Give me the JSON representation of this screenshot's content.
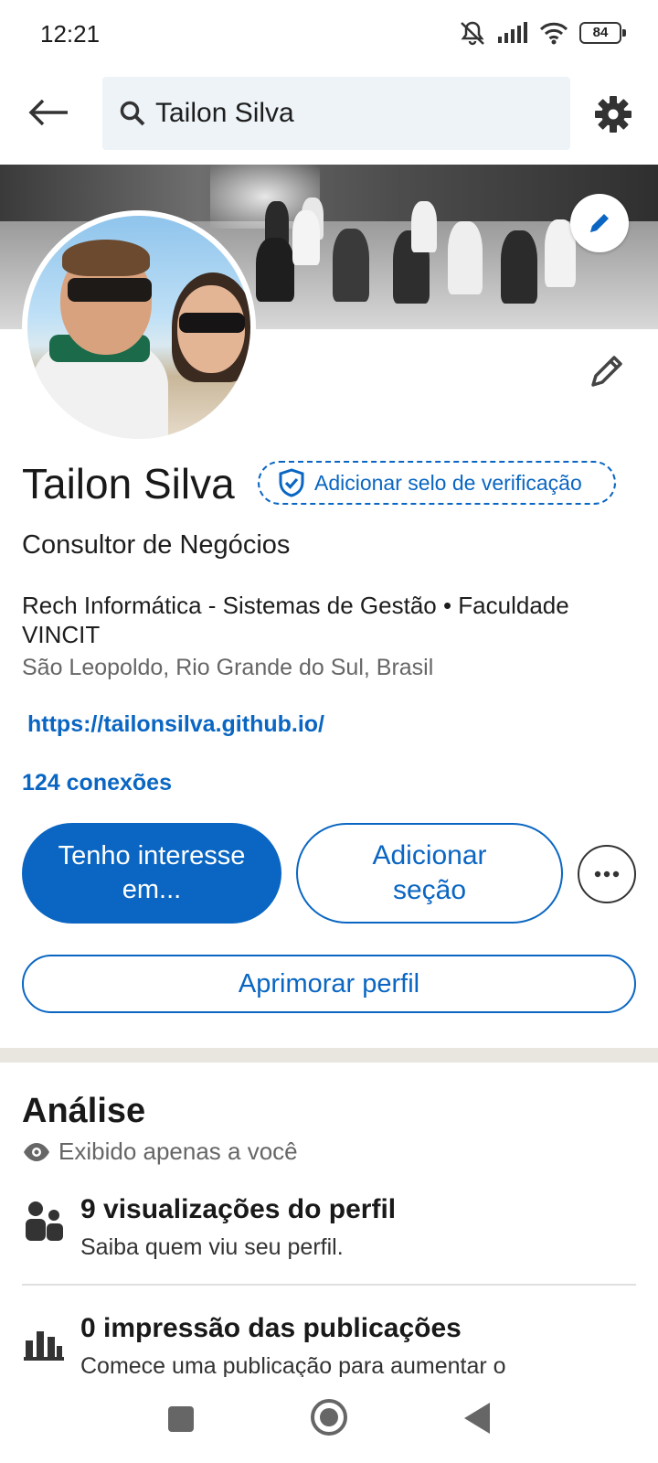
{
  "status_bar": {
    "time": "12:21",
    "battery": "84"
  },
  "header": {
    "search_value": "Tailon Silva"
  },
  "profile": {
    "name": "Tailon Silva",
    "verify_label": "Adicionar selo de verificação",
    "headline": "Consultor de Negócios",
    "workplace": "Rech Informática - Sistemas de Gestão • Faculdade VINCIT",
    "location": "São Leopoldo, Rio Grande do Sul, Brasil",
    "website": "https://tailonsilva.github.io/",
    "connections": "124 conexões"
  },
  "actions": {
    "primary_label": "Tenho interesse em...",
    "add_section_label": "Adicionar seção",
    "improve_label": "Aprimorar perfil"
  },
  "analytics": {
    "title": "Análise",
    "private_note": "Exibido apenas a você",
    "metrics": [
      {
        "title": "9 visualizações do perfil",
        "subtitle": "Saiba quem viu seu perfil."
      },
      {
        "title": "0 impressão das publicações",
        "subtitle": "Comece uma publicação para aumentar o"
      }
    ]
  },
  "colors": {
    "accent": "#0a66c2",
    "muted_text": "#666666",
    "divider": "#e9e5df"
  }
}
